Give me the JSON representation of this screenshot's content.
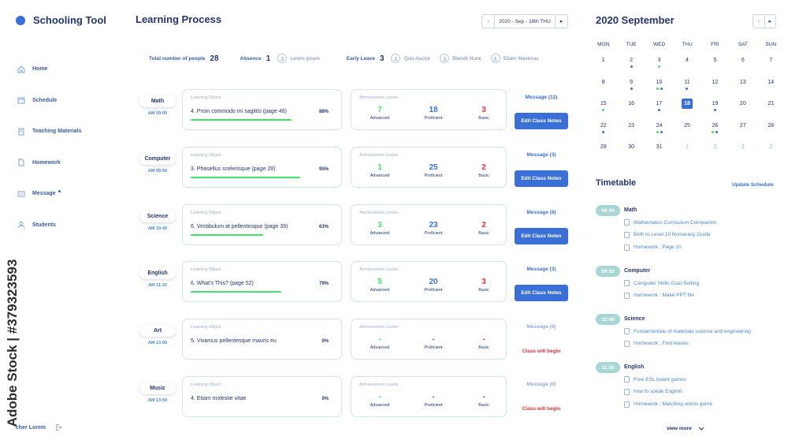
{
  "brand": {
    "title": "Schooling Tool"
  },
  "sidebar": {
    "items": [
      {
        "label": "Home",
        "icon": "home-icon"
      },
      {
        "label": "Schedule",
        "icon": "calendar-icon"
      },
      {
        "label": "Teaching Materials",
        "icon": "book-icon"
      },
      {
        "label": "Homework",
        "icon": "document-icon"
      },
      {
        "label": "Message",
        "icon": "message-icon",
        "has_dot": true
      },
      {
        "label": "Students",
        "icon": "user-icon"
      }
    ],
    "user": "cher Lorem"
  },
  "watermark": "Adobe Stock | #379323593",
  "main": {
    "title": "Learning Process",
    "date": "2020 - Sep - 18th THU",
    "stats": {
      "total_label": "Total number of people",
      "total": "28",
      "absence_label": "Absence",
      "absence": "1",
      "absence_names": [
        "Lorem ipsum"
      ],
      "leave_label": "Early Leave",
      "leave": "3",
      "leave_names": [
        "Quis Auctor",
        "Blandit Nunc",
        "Etiam Maximus"
      ]
    },
    "lo_label": "Learning Object",
    "ach_label": "Achievement Levels",
    "level_names": [
      "Advanced",
      "Proficient",
      "Basic"
    ],
    "edit_label": "Edit Class Notes",
    "begin_label": "Class will begin",
    "rows": [
      {
        "subject": "Math",
        "time": "AM 09:00",
        "object": "4.  Proin commodo mi sagittis (page 46)",
        "pct": "88%",
        "progress": 0.88,
        "advanced": "7",
        "proficient": "18",
        "basic": "3",
        "message": "Message (12)",
        "state": "edit"
      },
      {
        "subject": "Computer",
        "time": "AM 09:50",
        "object": "3. Phasellus scelerisque  (page 28)",
        "pct": "95%",
        "progress": 0.95,
        "advanced": "1",
        "proficient": "25",
        "basic": "2",
        "message": "Message (3)",
        "state": "edit"
      },
      {
        "subject": "Science",
        "time": "AM 10:40",
        "object": "6. Vestibulum at pellentesque (page 39)",
        "pct": "63%",
        "progress": 0.63,
        "advanced": "3",
        "proficient": "23",
        "basic": "2",
        "message": "Message (8)",
        "state": "edit"
      },
      {
        "subject": "English",
        "time": "AM 11:30",
        "object": "6. What's This? (page 52)",
        "pct": "79%",
        "progress": 0.79,
        "advanced": "5",
        "proficient": "20",
        "basic": "3",
        "message": "Message (3)",
        "state": "edit"
      },
      {
        "subject": "Art",
        "time": "AM 13:00",
        "object": "5. Vivamus pellentesque mauris eu",
        "pct": "0%",
        "progress": 0,
        "advanced": "-",
        "proficient": "-",
        "basic": "-",
        "message": "Message (0)",
        "state": "begin"
      },
      {
        "subject": "Music",
        "time": "AM 13:50",
        "object": "4. Etiam molestie vitae",
        "pct": "0%",
        "progress": 0,
        "advanced": "-",
        "proficient": "-",
        "basic": "-",
        "message": "Message (0)",
        "state": "begin"
      }
    ]
  },
  "calendar": {
    "title": "2020 September",
    "weekdays": [
      "MON",
      "TUE",
      "WED",
      "THU",
      "FRI",
      "SAT",
      "SUN"
    ],
    "weeks": [
      [
        {
          "d": "1"
        },
        {
          "d": "2",
          "dots": [
            "blue"
          ]
        },
        {
          "d": "3",
          "dots": [
            "green"
          ]
        },
        {
          "d": "4"
        },
        {
          "d": "5"
        },
        {
          "d": "6"
        },
        {
          "d": "7"
        }
      ],
      [
        {
          "d": "8"
        },
        {
          "d": "9",
          "dots": [
            "blue"
          ]
        },
        {
          "d": "10",
          "dots": [
            "green",
            "blue"
          ]
        },
        {
          "d": "11",
          "dots": [
            "blue"
          ]
        },
        {
          "d": "12"
        },
        {
          "d": "13"
        },
        {
          "d": "14"
        }
      ],
      [
        {
          "d": "15",
          "dots": [
            "green"
          ]
        },
        {
          "d": "16"
        },
        {
          "d": "17",
          "dots": [
            "blue"
          ]
        },
        {
          "d": "18",
          "today": true
        },
        {
          "d": "19",
          "dots": [
            "blue"
          ]
        },
        {
          "d": "20"
        },
        {
          "d": "21"
        }
      ],
      [
        {
          "d": "22",
          "dots": [
            "blue"
          ]
        },
        {
          "d": "23"
        },
        {
          "d": "24",
          "dots": [
            "green",
            "blue"
          ]
        },
        {
          "d": "25"
        },
        {
          "d": "26",
          "dots": [
            "green",
            "blue"
          ]
        },
        {
          "d": "27"
        },
        {
          "d": "28"
        }
      ],
      [
        {
          "d": "29"
        },
        {
          "d": "30"
        },
        {
          "d": "31"
        },
        {
          "d": "1",
          "other": true
        },
        {
          "d": "2",
          "other": true
        },
        {
          "d": "3",
          "other": true
        },
        {
          "d": "2",
          "other": true
        }
      ]
    ],
    "colors": {
      "blue": "#3b6fd8",
      "green": "#3ee36a"
    }
  },
  "timetable": {
    "title": "Timetable",
    "update_label": "Update Schedule",
    "blocks": [
      {
        "time": "09:00",
        "subject": "Math",
        "items": [
          "Mathematics Curriculum Companion",
          "Birth to Level 10 Numeracy Guide",
          "Homework : Page 10"
        ]
      },
      {
        "time": "09:50",
        "subject": "Computer",
        "items": [
          "Computer Skills Goal Setting",
          "Homework : Make PPT file"
        ]
      },
      {
        "time": "10:40",
        "subject": "Science",
        "items": [
          "Fundamentals of materials science and engineering",
          "Homework : Find leaves"
        ]
      },
      {
        "time": "11:30",
        "subject": "English",
        "items": [
          "Free ESL board games",
          "how to speak English.",
          "Homework : Matching words game"
        ]
      }
    ],
    "view_more": "view more"
  }
}
